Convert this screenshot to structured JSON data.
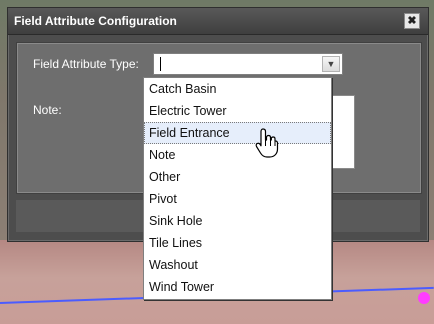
{
  "dialog": {
    "title": "Field Attribute Configuration",
    "close_label": "✖"
  },
  "form": {
    "type_label": "Field Attribute Type:",
    "note_label": "Note:",
    "type_value": ""
  },
  "dropdown": {
    "options": [
      "Catch Basin",
      "Electric Tower",
      "Field Entrance",
      "Note",
      "Other",
      "Pivot",
      "Sink Hole",
      "Tile Lines",
      "Washout",
      "Wind Tower"
    ],
    "hovered": "Field Entrance"
  },
  "icons": {
    "close": "close-icon",
    "dropdown_arrow": "chevron-down-icon",
    "cursor": "hand-pointer-icon"
  }
}
